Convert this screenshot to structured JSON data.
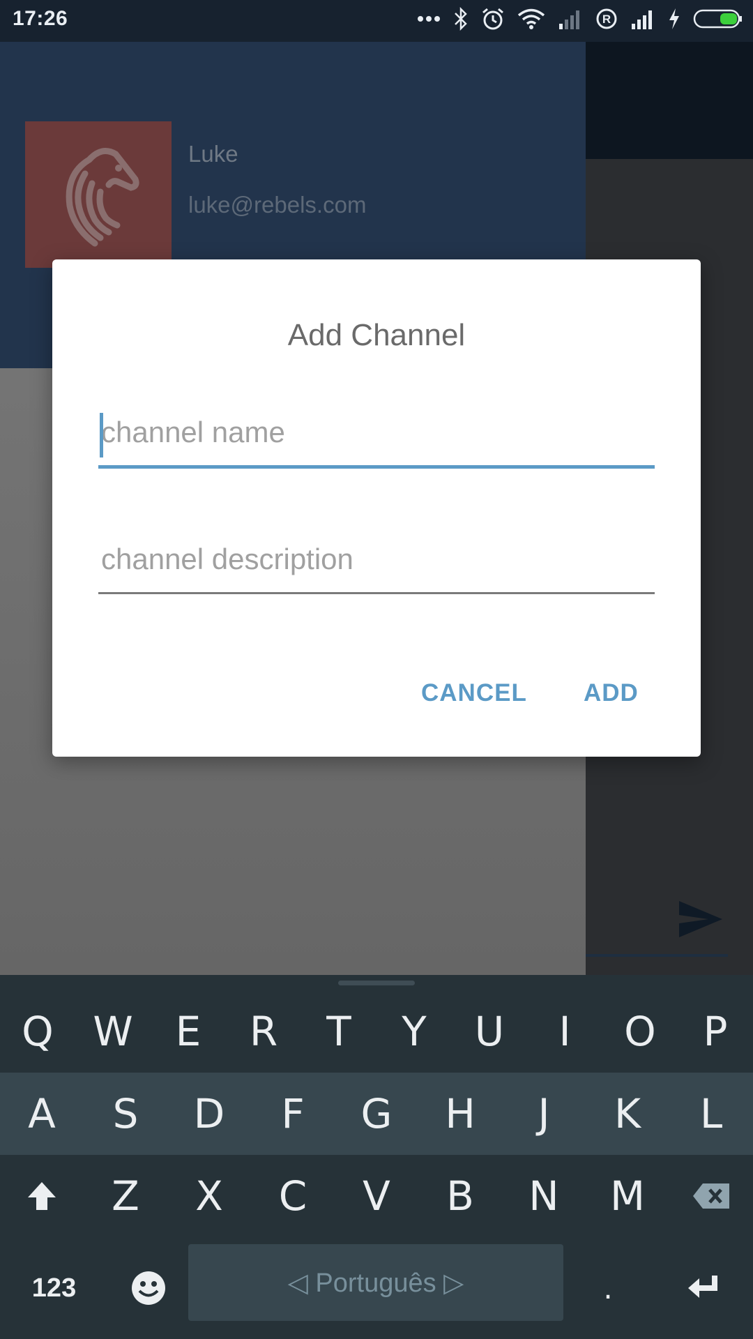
{
  "status_bar": {
    "time": "17:26",
    "icons": [
      "more-dots-icon",
      "bluetooth-icon",
      "alarm-icon",
      "wifi-icon",
      "signal-weak-icon",
      "roaming-r-icon",
      "signal-full-icon",
      "charging-bolt-icon",
      "battery-icon"
    ]
  },
  "drawer": {
    "user_name": "Luke",
    "user_email": "luke@rebels.com"
  },
  "dialog": {
    "title": "Add Channel",
    "name_placeholder": "channel name",
    "name_value": "",
    "description_placeholder": "channel description",
    "description_value": "",
    "cancel_label": "CANCEL",
    "add_label": "ADD"
  },
  "keyboard": {
    "row1": [
      "Q",
      "W",
      "E",
      "R",
      "T",
      "Y",
      "U",
      "I",
      "O",
      "P"
    ],
    "row2": [
      "A",
      "S",
      "D",
      "F",
      "G",
      "H",
      "J",
      "K",
      "L"
    ],
    "row3": [
      "Z",
      "X",
      "C",
      "V",
      "B",
      "N",
      "M"
    ],
    "num_label": "123",
    "space_label": "◁ Português ▷",
    "period_label": "."
  },
  "colors": {
    "accent": "#5b9ac6",
    "status_bar": "#17222f",
    "drawer_header": "#22344c",
    "keyboard_bg": "#263238"
  }
}
